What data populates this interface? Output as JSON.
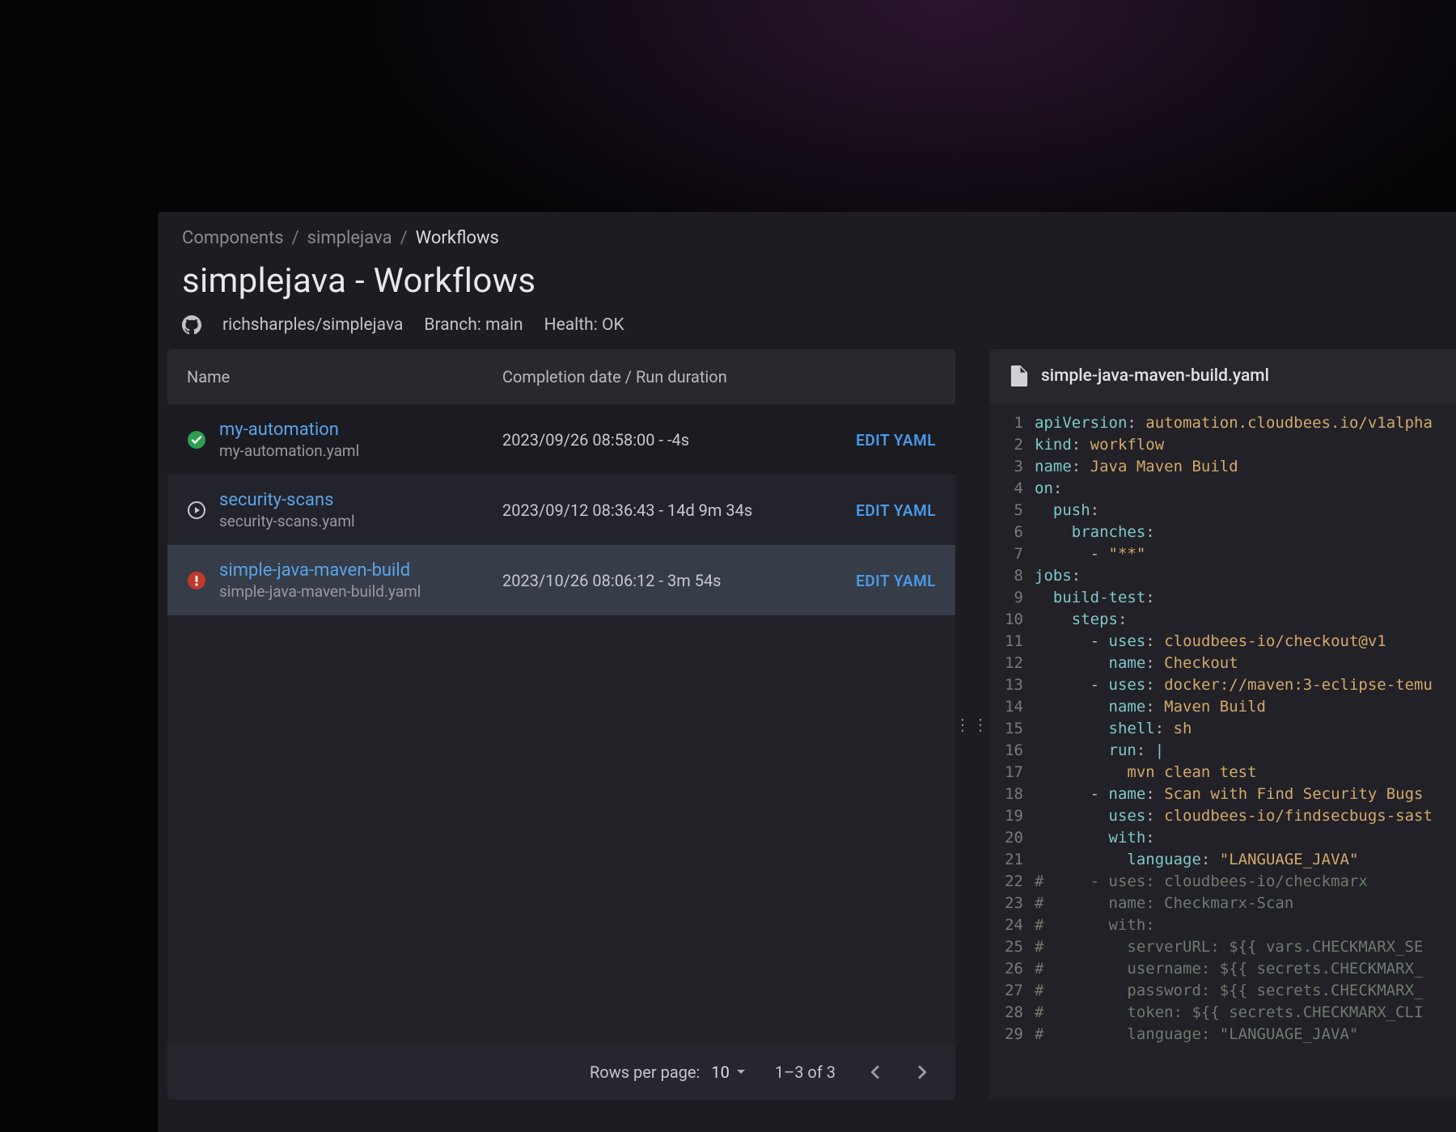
{
  "breadcrumb": {
    "root": "Components",
    "mid": "simplejava",
    "current": "Workflows"
  },
  "page_title": "simplejava - Workflows",
  "meta": {
    "repo": "richsharples/simplejava",
    "branch_label": "Branch: main",
    "health_label": "Health: OK"
  },
  "table": {
    "headers": {
      "name": "Name",
      "date": "Completion date / Run duration"
    },
    "rows": [
      {
        "status": "success",
        "name": "my-automation",
        "file": "my-automation.yaml",
        "date": "2023/09/26 08:58:00 - -4s",
        "action": "EDIT YAML"
      },
      {
        "status": "running",
        "name": "security-scans",
        "file": "security-scans.yaml",
        "date": "2023/09/12 08:36:43 - 14d 9m 34s",
        "action": "EDIT YAML"
      },
      {
        "status": "error",
        "name": "simple-java-maven-build",
        "file": "simple-java-maven-build.yaml",
        "date": "2023/10/26 08:06:12 - 3m 54s",
        "action": "EDIT YAML"
      }
    ],
    "footer": {
      "rows_label": "Rows per page:",
      "rows_value": "10",
      "range": "1–3 of 3"
    }
  },
  "editor": {
    "file_name": "simple-java-maven-build.yaml",
    "lines": [
      {
        "n": 1,
        "segs": [
          {
            "c": "tok-key",
            "t": "apiVersion"
          },
          {
            "c": "tok-punct",
            "t": ": "
          },
          {
            "c": "tok-val",
            "t": "automation.cloudbees.io/v1alpha"
          }
        ]
      },
      {
        "n": 2,
        "segs": [
          {
            "c": "tok-key",
            "t": "kind"
          },
          {
            "c": "tok-punct",
            "t": ": "
          },
          {
            "c": "tok-val",
            "t": "workflow"
          }
        ]
      },
      {
        "n": 3,
        "segs": [
          {
            "c": "tok-key",
            "t": "name"
          },
          {
            "c": "tok-punct",
            "t": ": "
          },
          {
            "c": "tok-val",
            "t": "Java Maven Build"
          }
        ]
      },
      {
        "n": 4,
        "segs": [
          {
            "c": "tok-key",
            "t": "on"
          },
          {
            "c": "tok-punct",
            "t": ":"
          }
        ]
      },
      {
        "n": 5,
        "segs": [
          {
            "c": "tok-guide",
            "t": "  "
          },
          {
            "c": "tok-key",
            "t": "push"
          },
          {
            "c": "tok-punct",
            "t": ":"
          }
        ]
      },
      {
        "n": 6,
        "segs": [
          {
            "c": "tok-guide",
            "t": "    "
          },
          {
            "c": "tok-key",
            "t": "branches"
          },
          {
            "c": "tok-punct",
            "t": ":"
          }
        ]
      },
      {
        "n": 7,
        "segs": [
          {
            "c": "tok-guide",
            "t": "      "
          },
          {
            "c": "tok-dash",
            "t": "- "
          },
          {
            "c": "tok-str",
            "t": "\"**\""
          }
        ]
      },
      {
        "n": 8,
        "segs": [
          {
            "c": "tok-key",
            "t": "jobs"
          },
          {
            "c": "tok-punct",
            "t": ":"
          }
        ]
      },
      {
        "n": 9,
        "segs": [
          {
            "c": "tok-guide",
            "t": "  "
          },
          {
            "c": "tok-key",
            "t": "build-test"
          },
          {
            "c": "tok-punct",
            "t": ":"
          }
        ]
      },
      {
        "n": 10,
        "segs": [
          {
            "c": "tok-guide",
            "t": "    "
          },
          {
            "c": "tok-key",
            "t": "steps"
          },
          {
            "c": "tok-punct",
            "t": ":"
          }
        ]
      },
      {
        "n": 11,
        "segs": [
          {
            "c": "tok-guide",
            "t": "      "
          },
          {
            "c": "tok-dash",
            "t": "- "
          },
          {
            "c": "tok-key",
            "t": "uses"
          },
          {
            "c": "tok-punct",
            "t": ": "
          },
          {
            "c": "tok-val",
            "t": "cloudbees-io/checkout@v1"
          }
        ]
      },
      {
        "n": 12,
        "segs": [
          {
            "c": "tok-guide",
            "t": "        "
          },
          {
            "c": "tok-key",
            "t": "name"
          },
          {
            "c": "tok-punct",
            "t": ": "
          },
          {
            "c": "tok-val",
            "t": "Checkout"
          }
        ]
      },
      {
        "n": 13,
        "segs": [
          {
            "c": "tok-guide",
            "t": "      "
          },
          {
            "c": "tok-dash",
            "t": "- "
          },
          {
            "c": "tok-key",
            "t": "uses"
          },
          {
            "c": "tok-punct",
            "t": ": "
          },
          {
            "c": "tok-val",
            "t": "docker://maven:3-eclipse-temu"
          }
        ]
      },
      {
        "n": 14,
        "segs": [
          {
            "c": "tok-guide",
            "t": "        "
          },
          {
            "c": "tok-key",
            "t": "name"
          },
          {
            "c": "tok-punct",
            "t": ": "
          },
          {
            "c": "tok-val",
            "t": "Maven Build"
          }
        ]
      },
      {
        "n": 15,
        "segs": [
          {
            "c": "tok-guide",
            "t": "        "
          },
          {
            "c": "tok-key",
            "t": "shell"
          },
          {
            "c": "tok-punct",
            "t": ": "
          },
          {
            "c": "tok-val",
            "t": "sh"
          }
        ]
      },
      {
        "n": 16,
        "segs": [
          {
            "c": "tok-guide",
            "t": "        "
          },
          {
            "c": "tok-key",
            "t": "run"
          },
          {
            "c": "tok-punct",
            "t": ": "
          },
          {
            "c": "tok-pipe",
            "t": "|"
          }
        ]
      },
      {
        "n": 17,
        "segs": [
          {
            "c": "tok-guide",
            "t": "          "
          },
          {
            "c": "tok-val",
            "t": "mvn clean test"
          }
        ]
      },
      {
        "n": 18,
        "segs": [
          {
            "c": "tok-guide",
            "t": "      "
          },
          {
            "c": "tok-dash",
            "t": "- "
          },
          {
            "c": "tok-key",
            "t": "name"
          },
          {
            "c": "tok-punct",
            "t": ": "
          },
          {
            "c": "tok-val",
            "t": "Scan with Find Security Bugs"
          }
        ]
      },
      {
        "n": 19,
        "segs": [
          {
            "c": "tok-guide",
            "t": "        "
          },
          {
            "c": "tok-key",
            "t": "uses"
          },
          {
            "c": "tok-punct",
            "t": ": "
          },
          {
            "c": "tok-val",
            "t": "cloudbees-io/findsecbugs-sast"
          }
        ]
      },
      {
        "n": 20,
        "segs": [
          {
            "c": "tok-guide",
            "t": "        "
          },
          {
            "c": "tok-key",
            "t": "with"
          },
          {
            "c": "tok-punct",
            "t": ":"
          }
        ]
      },
      {
        "n": 21,
        "segs": [
          {
            "c": "tok-guide",
            "t": "          "
          },
          {
            "c": "tok-key",
            "t": "language"
          },
          {
            "c": "tok-punct",
            "t": ": "
          },
          {
            "c": "tok-str",
            "t": "\"LANGUAGE_JAVA\""
          }
        ]
      },
      {
        "n": 22,
        "segs": [
          {
            "c": "tok-comment",
            "t": "#     - uses: cloudbees-io/checkmarx"
          }
        ]
      },
      {
        "n": 23,
        "segs": [
          {
            "c": "tok-comment",
            "t": "#       name: Checkmarx-Scan"
          }
        ]
      },
      {
        "n": 24,
        "segs": [
          {
            "c": "tok-comment",
            "t": "#       with:"
          }
        ]
      },
      {
        "n": 25,
        "segs": [
          {
            "c": "tok-comment",
            "t": "#         serverURL: ${{ vars.CHECKMARX_SE"
          }
        ]
      },
      {
        "n": 26,
        "segs": [
          {
            "c": "tok-comment",
            "t": "#         username: ${{ secrets.CHECKMARX_"
          }
        ]
      },
      {
        "n": 27,
        "segs": [
          {
            "c": "tok-comment",
            "t": "#         password: ${{ secrets.CHECKMARX_"
          }
        ]
      },
      {
        "n": 28,
        "segs": [
          {
            "c": "tok-comment",
            "t": "#         token: ${{ secrets.CHECKMARX_CLI"
          }
        ]
      },
      {
        "n": 29,
        "segs": [
          {
            "c": "tok-comment",
            "t": "#         language: \"LANGUAGE_JAVA\""
          }
        ]
      }
    ]
  }
}
